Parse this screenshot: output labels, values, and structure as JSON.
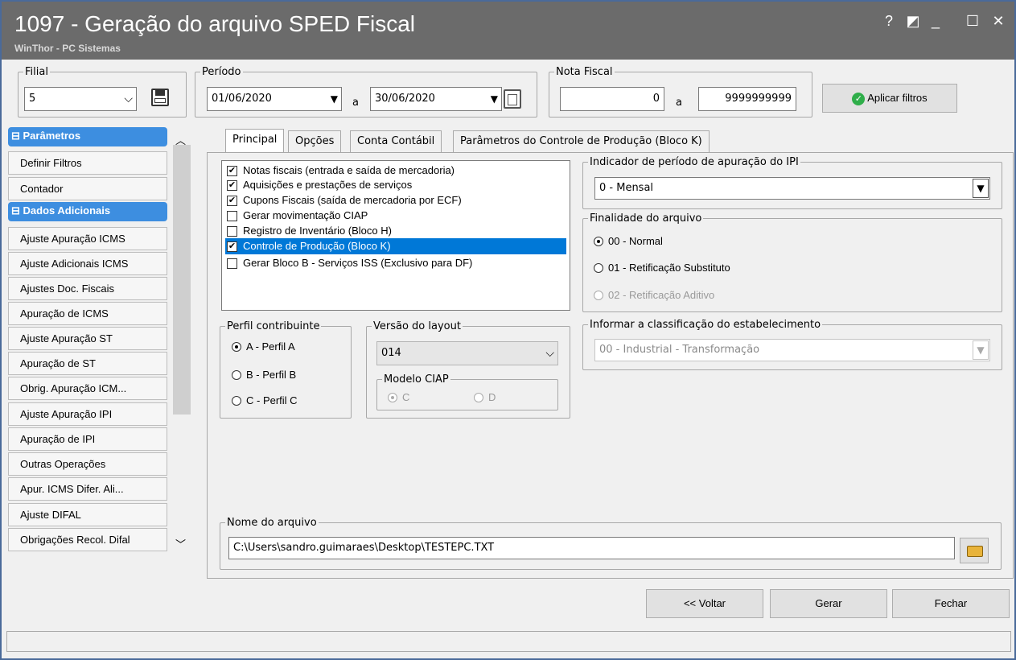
{
  "window": {
    "title": "1097 - Geração do arquivo SPED Fiscal",
    "subtitle": "WinThor - PC Sistemas",
    "controls": [
      "?",
      "◩",
      "_",
      "☐",
      "✕"
    ]
  },
  "filters": {
    "filial": {
      "label": "Filial",
      "value": "5"
    },
    "periodo": {
      "label": "Período",
      "start": "01/06/2020",
      "sep": "a",
      "end": "30/06/2020"
    },
    "nota": {
      "label": "Nota Fiscal",
      "start": "0",
      "sep": "a",
      "end": "9999999999"
    },
    "apply_label": "Aplicar filtros"
  },
  "sidebar": {
    "sections": [
      {
        "title": "Parâmetros",
        "items": [
          "Definir Filtros",
          "Contador"
        ]
      },
      {
        "title": "Dados Adicionais",
        "items": [
          "Ajuste Apuração ICMS",
          "Ajuste Adicionais ICMS",
          "Ajustes Doc. Fiscais",
          "Apuração de ICMS",
          "Ajuste Apuração ST",
          "Apuração de ST",
          "Obrig. Apuração ICM...",
          "Ajuste Apuração IPI",
          "Apuração de IPI",
          "Outras Operações",
          "Apur. ICMS Difer. Ali...",
          "Ajuste DIFAL",
          "Obrigações Recol. Difal"
        ]
      }
    ]
  },
  "tabs": [
    "Principal",
    "Opções",
    "Conta Contábil",
    "Parâmetros do Controle de Produção (Bloco K)"
  ],
  "options": [
    {
      "label": "Notas fiscais (entrada e saída de mercadoria)",
      "checked": true
    },
    {
      "label": "Aquisições e prestações de serviços",
      "checked": true
    },
    {
      "label": "Cupons Fiscais (saída de mercadoria por ECF)",
      "checked": true
    },
    {
      "label": "Gerar movimentação CIAP",
      "checked": false
    },
    {
      "label": "Registro de Inventário (Bloco H)",
      "checked": false
    },
    {
      "label": "Controle de Produção (Bloco K)",
      "checked": true,
      "selected": true
    },
    {
      "label": "Gerar Bloco B - Serviços ISS (Exclusivo para DF)",
      "checked": false
    }
  ],
  "perfil": {
    "label": "Perfil contribuinte",
    "options": [
      "A - Perfil A",
      "B - Perfil B",
      "C - Perfil C"
    ],
    "selected": 0
  },
  "layout": {
    "label": "Versão do layout",
    "value": "014",
    "ciap_label": "Modelo CIAP",
    "ciap_options": [
      "C",
      "D"
    ]
  },
  "ipi": {
    "label": "Indicador de período de apuração do IPI",
    "value": "0 - Mensal"
  },
  "finalidade": {
    "label": "Finalidade do arquivo",
    "options": [
      "00 - Normal",
      "01 - Retificação Substituto",
      "02 - Retificação Aditivo"
    ],
    "selected": 0
  },
  "classificacao": {
    "label": "Informar a classificação do estabelecimento",
    "value": "00 - Industrial - Transformação"
  },
  "arquivo": {
    "label": "Nome do arquivo",
    "value": "C:\\Users\\sandro.guimaraes\\Desktop\\TESTEPC.TXT"
  },
  "buttons": {
    "back": "<< Voltar",
    "generate": "Gerar",
    "close": "Fechar"
  }
}
